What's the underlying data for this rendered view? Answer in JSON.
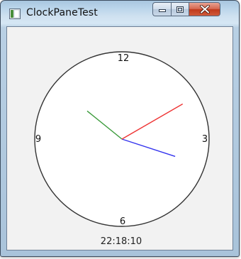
{
  "window": {
    "title": "ClockPaneTest",
    "controls": {
      "minimize": "minimize-icon",
      "maximize": "maximize-icon",
      "close": "close-icon"
    }
  },
  "clock": {
    "numbers": {
      "twelve": "12",
      "three": "3",
      "six": "6",
      "nine": "9"
    },
    "time_text": "22:18:10",
    "time": {
      "hour": 22,
      "minute": 18,
      "second": 10
    },
    "colors": {
      "face_fill": "#ffffff",
      "face_stroke": "#333333",
      "hour_hand": "#3a9a3a",
      "minute_hand": "#3333ee",
      "second_hand": "#ee3333"
    }
  }
}
